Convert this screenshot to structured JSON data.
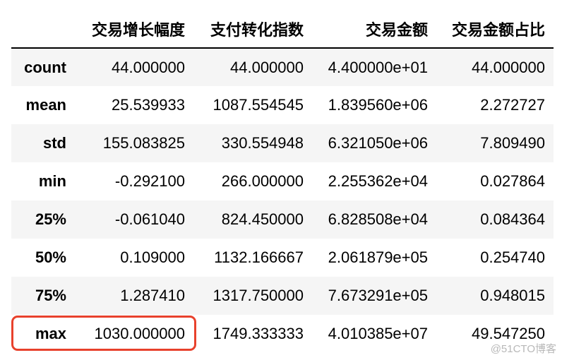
{
  "table": {
    "columns": [
      "",
      "交易增长幅度",
      "支付转化指数",
      "交易金额",
      "交易金额占比"
    ],
    "rows": [
      {
        "label": "count",
        "values": [
          "44.000000",
          "44.000000",
          "4.400000e+01",
          "44.000000"
        ]
      },
      {
        "label": "mean",
        "values": [
          "25.539933",
          "1087.554545",
          "1.839560e+06",
          "2.272727"
        ]
      },
      {
        "label": "std",
        "values": [
          "155.083825",
          "330.554948",
          "6.321050e+06",
          "7.809490"
        ]
      },
      {
        "label": "min",
        "values": [
          "-0.292100",
          "266.000000",
          "2.255362e+04",
          "0.027864"
        ]
      },
      {
        "label": "25%",
        "values": [
          "-0.061040",
          "824.450000",
          "6.828508e+04",
          "0.084364"
        ]
      },
      {
        "label": "50%",
        "values": [
          "0.109000",
          "1132.166667",
          "2.061879e+05",
          "0.254740"
        ]
      },
      {
        "label": "75%",
        "values": [
          "1.287410",
          "1317.750000",
          "7.673291e+05",
          "0.948015"
        ]
      },
      {
        "label": "max",
        "values": [
          "1030.000000",
          "1749.333333",
          "4.010385e+07",
          "49.547250"
        ]
      }
    ]
  },
  "highlight": {
    "row": "max",
    "column": "交易增长幅度",
    "color": "#e8412c"
  },
  "watermark": "@51CTO博客"
}
